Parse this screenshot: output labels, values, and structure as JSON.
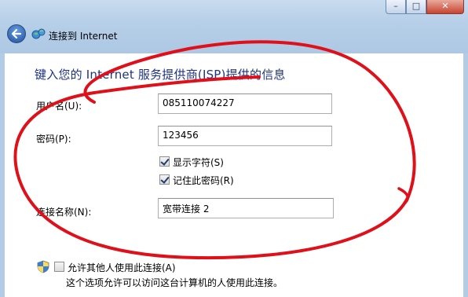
{
  "window": {
    "title": "连接到 Internet",
    "buttons": {
      "minimize": "–",
      "maximize": "□",
      "close": "✕"
    }
  },
  "heading": "键入您的 Internet 服务提供商(ISP)提供的信息",
  "fields": {
    "username": {
      "label": "用户名(U):",
      "value": "085110074227"
    },
    "password": {
      "label": "密码(P):",
      "value": "123456"
    },
    "connection_name": {
      "label": "连接名称(N):",
      "value": "宽带连接 2"
    }
  },
  "checkboxes": {
    "show_chars": {
      "label": "显示字符(S)",
      "checked": true
    },
    "remember_password": {
      "label": "记住此密码(R)",
      "checked": true
    },
    "allow_others": {
      "label": "允许其他人使用此连接(A)",
      "checked": false
    }
  },
  "note": "这个选项允许可以访问这台计算机的人使用此连接。",
  "icons": [
    "back-arrow-icon",
    "network-icon",
    "uac-shield-icon"
  ],
  "colors": {
    "heading": "#1e3287",
    "annotation": "#e0101a",
    "titlebar": "#b7cfe8"
  }
}
